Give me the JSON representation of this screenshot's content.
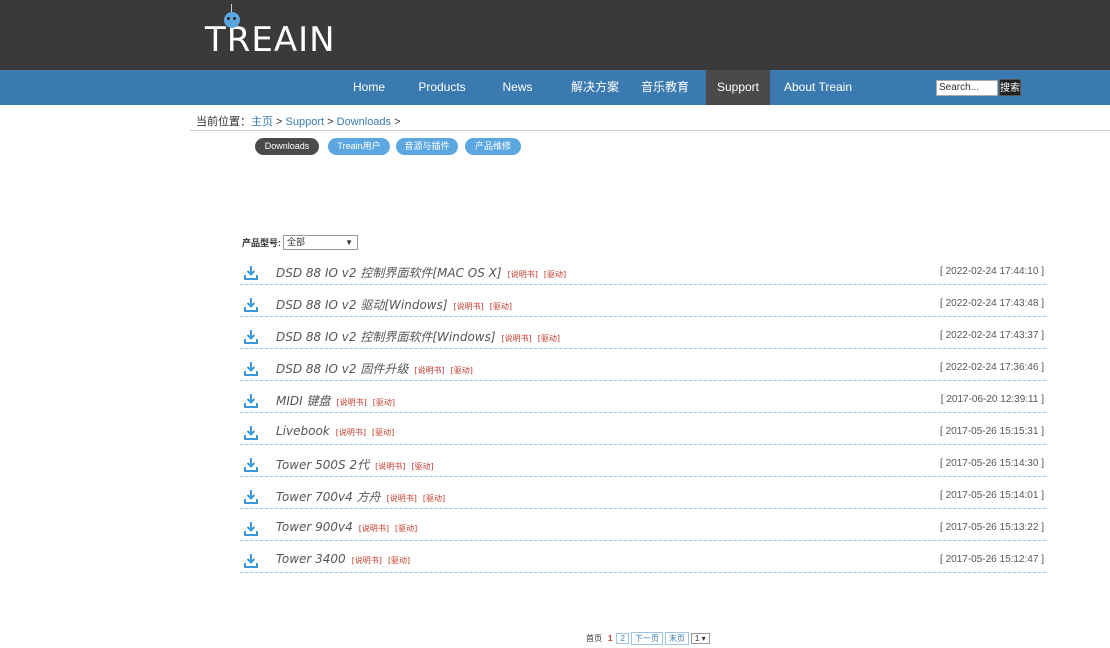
{
  "header": {
    "logo": "TREAIN"
  },
  "nav": [
    {
      "label": "Home"
    },
    {
      "label": "Products"
    },
    {
      "label": "News"
    },
    {
      "label": "解决方案"
    },
    {
      "label": "音乐教育"
    },
    {
      "label": "Support",
      "active": true
    },
    {
      "label": "About Treain"
    }
  ],
  "search": {
    "placeholder": "Search...",
    "button": "搜索"
  },
  "breadcrumb": {
    "prefix": "当前位置：",
    "home": "主页",
    "sep1": " > ",
    "support": "Support",
    "sep2": " > ",
    "downloads": "Downloads",
    "sep3": " >"
  },
  "tabs": [
    {
      "label": "Downloads",
      "active": true
    },
    {
      "label": "Treain用户"
    },
    {
      "label": "音源与插件"
    },
    {
      "label": "产品维修"
    }
  ],
  "filter": {
    "label": "产品型号:",
    "value": "全部"
  },
  "downloads": [
    {
      "title": "DSD 88 IO v2 控制界面软件[MAC OS X]",
      "manual": "[说明书]",
      "driver": "[驱动]",
      "date": "[ 2022-02-24 17:44:10 ]"
    },
    {
      "title": "DSD 88 IO v2 驱动[Windows]",
      "manual": "[说明书]",
      "driver": "[驱动]",
      "date": "[ 2022-02-24 17:43:48 ]"
    },
    {
      "title": "DSD 88 IO v2 控制界面软件[Windows]",
      "manual": "[说明书]",
      "driver": "[驱动]",
      "date": "[ 2022-02-24 17:43:37 ]"
    },
    {
      "title": "DSD 88 IO v2 固件升级",
      "manual": "[说明书]",
      "driver": "[驱动]",
      "date": "[ 2022-02-24 17:36:46 ]"
    },
    {
      "title": "MIDI 键盘",
      "manual": "[说明书]",
      "driver": "[驱动]",
      "date": "[ 2017-06-20 12:39:11 ]"
    },
    {
      "title": "Livebook",
      "manual": "[说明书]",
      "driver": "[驱动]",
      "date": "[ 2017-05-26 15:15:31 ]"
    },
    {
      "title": "Tower 500S 2代",
      "manual": "[说明书]",
      "driver": "[驱动]",
      "date": "[ 2017-05-26 15:14:30 ]"
    },
    {
      "title": "Tower 700v4 方舟",
      "manual": "[说明书]",
      "driver": "[驱动]",
      "date": "[ 2017-05-26 15:14:01 ]"
    },
    {
      "title": "Tower 900v4",
      "manual": "[说明书]",
      "driver": "[驱动]",
      "date": "[ 2017-05-26 15:13:22 ]"
    },
    {
      "title": "Tower 3400",
      "manual": "[说明书]",
      "driver": "[驱动]",
      "date": "[ 2017-05-26 15:12:47 ]"
    }
  ],
  "pager": {
    "first": "首页",
    "page1": "1",
    "page2": "2",
    "next": "下一页",
    "last": "末页",
    "select": "1"
  },
  "colors": {
    "topbar": "#3a3a3a",
    "navbar": "#3a7ab0",
    "accent_blue": "#5da7e0",
    "link_red": "#c0392b"
  },
  "icons": {
    "download": "download-icon"
  }
}
